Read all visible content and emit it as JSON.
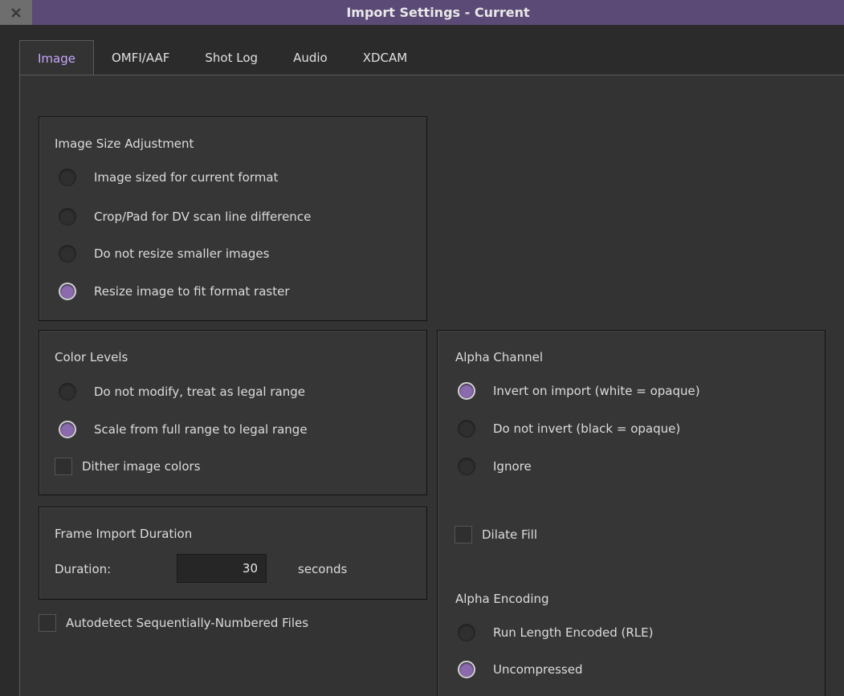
{
  "window": {
    "title": "Import Settings - Current"
  },
  "tabs": [
    {
      "label": "Image",
      "active": true
    },
    {
      "label": "OMFI/AAF",
      "active": false
    },
    {
      "label": "Shot Log",
      "active": false
    },
    {
      "label": "Audio",
      "active": false
    },
    {
      "label": "XDCAM",
      "active": false
    }
  ],
  "image_size": {
    "title": "Image Size Adjustment",
    "options": [
      {
        "label": "Image sized for current format",
        "checked": false
      },
      {
        "label": "Crop/Pad for DV scan line difference",
        "checked": false
      },
      {
        "label": "Do not resize smaller images",
        "checked": false
      },
      {
        "label": "Resize image to fit format raster",
        "checked": true
      }
    ]
  },
  "color_levels": {
    "title": "Color Levels",
    "options": [
      {
        "label": "Do not modify, treat as legal range",
        "checked": false
      },
      {
        "label": "Scale from full range to legal range",
        "checked": true
      }
    ],
    "dither_label": "Dither image colors",
    "dither_checked": false
  },
  "frame_import": {
    "title": "Frame Import Duration",
    "duration_label": "Duration:",
    "duration_value": "30",
    "unit": "seconds"
  },
  "autodetect": {
    "label": "Autodetect Sequentially-Numbered Files",
    "checked": false
  },
  "alpha": {
    "title": "Alpha Channel",
    "options": [
      {
        "label": "Invert on import (white = opaque)",
        "checked": true
      },
      {
        "label": "Do not invert (black = opaque)",
        "checked": false
      },
      {
        "label": "Ignore",
        "checked": false
      }
    ],
    "dilate_label": "Dilate Fill",
    "dilate_checked": false,
    "encoding_title": "Alpha Encoding",
    "encoding_options": [
      {
        "label": "Run Length Encoded (RLE)",
        "checked": false
      },
      {
        "label": "Uncompressed",
        "checked": true
      }
    ]
  },
  "colors": {
    "accent": "#8b6bae",
    "tab_active_text": "#c9a7ff",
    "titlebar": "#5b4a75"
  }
}
